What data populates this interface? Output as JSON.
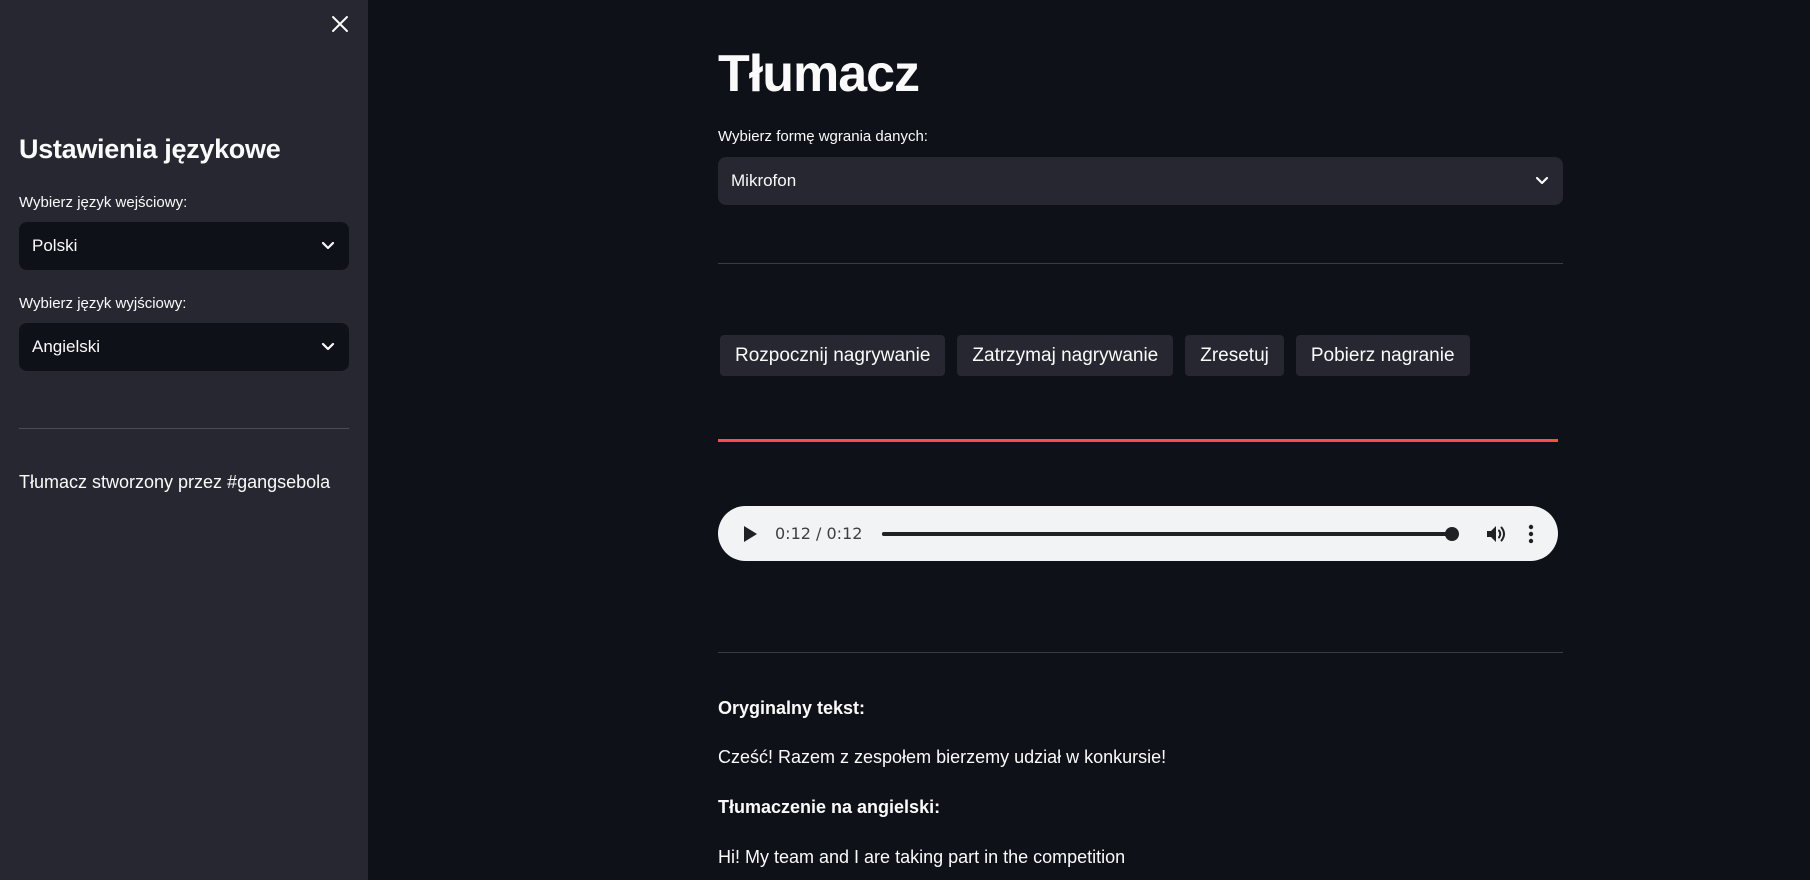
{
  "sidebar": {
    "title": "Ustawienia językowe",
    "input_language": {
      "label": "Wybierz język wejściowy:",
      "value": "Polski"
    },
    "output_language": {
      "label": "Wybierz język wyjściowy:",
      "value": "Angielski"
    },
    "footer": "Tłumacz stworzony przez #gangsebola"
  },
  "main": {
    "title": "Tłumacz",
    "upload_select": {
      "label": "Wybierz formę wgrania danych:",
      "value": "Mikrofon"
    },
    "buttons": {
      "start": "Rozpocznij nagrywanie",
      "stop": "Zatrzymaj nagrywanie",
      "reset": "Zresetuj",
      "download": "Pobierz nagranie"
    },
    "audio": {
      "time": "0:12 / 0:12",
      "progress": 1.0
    },
    "original_label": "Oryginalny tekst:",
    "original_text": "Cześć! Razem z zespołem bierzemy udział w konkursie!",
    "translation_label": "Tłumaczenie na angielski:",
    "translation_text": "Hi! My team and I are taking part in the competition"
  },
  "colors": {
    "app_background": "#0e1117",
    "sidebar_background": "#262730",
    "accent": "#ff4b4b",
    "text": "#fafafa"
  },
  "icons": [
    "close-icon",
    "chevron-down-icon",
    "play-icon",
    "volume-icon",
    "more-vert-icon"
  ]
}
